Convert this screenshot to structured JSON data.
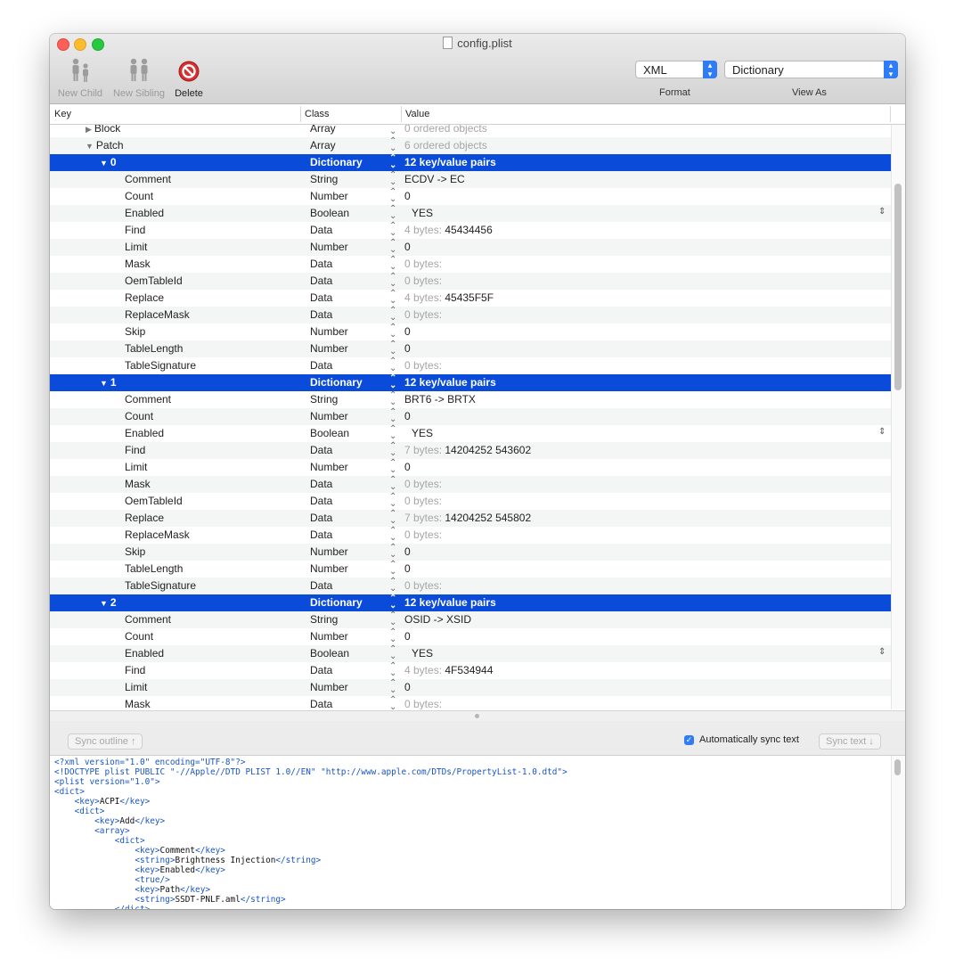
{
  "window": {
    "title": "config.plist"
  },
  "toolbar": {
    "new_child": "New Child",
    "new_sibling": "New Sibling",
    "delete": "Delete",
    "format_value": "XML",
    "format_label": "Format",
    "view_value": "Dictionary",
    "view_label": "View As"
  },
  "columns": {
    "key": "Key",
    "class": "Class",
    "value": "Value"
  },
  "rows": [
    {
      "key": "Block",
      "cls": "Array",
      "prefix": "",
      "value": "0 ordered objects",
      "level": 1,
      "disc": "▶",
      "muted": true
    },
    {
      "key": "Patch",
      "cls": "Array",
      "prefix": "",
      "value": "6 ordered objects",
      "level": 1,
      "disc": "▼",
      "muted": true
    },
    {
      "key": "0",
      "cls": "Dictionary",
      "prefix": "",
      "value": "12 key/value pairs",
      "level": 2,
      "disc": "▼",
      "sel": true
    },
    {
      "key": "Comment",
      "cls": "String",
      "prefix": "",
      "value": "ECDV -> EC",
      "level": 3
    },
    {
      "key": "Count",
      "cls": "Number",
      "prefix": "",
      "value": "0",
      "level": 3
    },
    {
      "key": "Enabled",
      "cls": "Boolean",
      "prefix": "",
      "value": "YES",
      "level": 3,
      "bool": true
    },
    {
      "key": "Find",
      "cls": "Data",
      "prefix": "4 bytes: ",
      "value": "45434456",
      "level": 3
    },
    {
      "key": "Limit",
      "cls": "Number",
      "prefix": "",
      "value": "0",
      "level": 3
    },
    {
      "key": "Mask",
      "cls": "Data",
      "prefix": "0 bytes:",
      "value": "",
      "level": 3
    },
    {
      "key": "OemTableId",
      "cls": "Data",
      "prefix": "0 bytes:",
      "value": "",
      "level": 3
    },
    {
      "key": "Replace",
      "cls": "Data",
      "prefix": "4 bytes: ",
      "value": "45435F5F",
      "level": 3
    },
    {
      "key": "ReplaceMask",
      "cls": "Data",
      "prefix": "0 bytes:",
      "value": "",
      "level": 3
    },
    {
      "key": "Skip",
      "cls": "Number",
      "prefix": "",
      "value": "0",
      "level": 3
    },
    {
      "key": "TableLength",
      "cls": "Number",
      "prefix": "",
      "value": "0",
      "level": 3
    },
    {
      "key": "TableSignature",
      "cls": "Data",
      "prefix": "0 bytes:",
      "value": "",
      "level": 3
    },
    {
      "key": "1",
      "cls": "Dictionary",
      "prefix": "",
      "value": "12 key/value pairs",
      "level": 2,
      "disc": "▼",
      "sel": true
    },
    {
      "key": "Comment",
      "cls": "String",
      "prefix": "",
      "value": "BRT6 -> BRTX",
      "level": 3
    },
    {
      "key": "Count",
      "cls": "Number",
      "prefix": "",
      "value": "0",
      "level": 3
    },
    {
      "key": "Enabled",
      "cls": "Boolean",
      "prefix": "",
      "value": "YES",
      "level": 3,
      "bool": true
    },
    {
      "key": "Find",
      "cls": "Data",
      "prefix": "7 bytes: ",
      "value": "14204252 543602",
      "level": 3
    },
    {
      "key": "Limit",
      "cls": "Number",
      "prefix": "",
      "value": "0",
      "level": 3
    },
    {
      "key": "Mask",
      "cls": "Data",
      "prefix": "0 bytes:",
      "value": "",
      "level": 3
    },
    {
      "key": "OemTableId",
      "cls": "Data",
      "prefix": "0 bytes:",
      "value": "",
      "level": 3
    },
    {
      "key": "Replace",
      "cls": "Data",
      "prefix": "7 bytes: ",
      "value": "14204252 545802",
      "level": 3
    },
    {
      "key": "ReplaceMask",
      "cls": "Data",
      "prefix": "0 bytes:",
      "value": "",
      "level": 3
    },
    {
      "key": "Skip",
      "cls": "Number",
      "prefix": "",
      "value": "0",
      "level": 3
    },
    {
      "key": "TableLength",
      "cls": "Number",
      "prefix": "",
      "value": "0",
      "level": 3
    },
    {
      "key": "TableSignature",
      "cls": "Data",
      "prefix": "0 bytes:",
      "value": "",
      "level": 3
    },
    {
      "key": "2",
      "cls": "Dictionary",
      "prefix": "",
      "value": "12 key/value pairs",
      "level": 2,
      "disc": "▼",
      "sel": true
    },
    {
      "key": "Comment",
      "cls": "String",
      "prefix": "",
      "value": "OSID -> XSID",
      "level": 3
    },
    {
      "key": "Count",
      "cls": "Number",
      "prefix": "",
      "value": "0",
      "level": 3
    },
    {
      "key": "Enabled",
      "cls": "Boolean",
      "prefix": "",
      "value": "YES",
      "level": 3,
      "bool": true
    },
    {
      "key": "Find",
      "cls": "Data",
      "prefix": "4 bytes: ",
      "value": "4F534944",
      "level": 3
    },
    {
      "key": "Limit",
      "cls": "Number",
      "prefix": "",
      "value": "0",
      "level": 3
    },
    {
      "key": "Mask",
      "cls": "Data",
      "prefix": "0 bytes:",
      "value": "",
      "level": 3
    }
  ],
  "sync": {
    "sync_outline": "Sync outline ↑",
    "auto_sync": "Automatically sync text",
    "auto_sync_checked": true,
    "sync_text": "Sync text ↓"
  },
  "code_lines": [
    [
      {
        "t": "tag",
        "s": "<?xml version=\"1.0\" encoding=\"UTF-8\"?>"
      }
    ],
    [
      {
        "t": "tag",
        "s": "<!DOCTYPE plist PUBLIC \"-//Apple//DTD PLIST 1.0//EN\" \"http://www.apple.com/DTDs/PropertyList-1.0.dtd\">"
      }
    ],
    [
      {
        "t": "tag",
        "s": "<plist version=\"1.0\">"
      }
    ],
    [
      {
        "t": "tag",
        "s": "<dict>"
      }
    ],
    [
      {
        "t": "txt",
        "s": "    "
      },
      {
        "t": "tag",
        "s": "<key>"
      },
      {
        "t": "txt",
        "s": "ACPI"
      },
      {
        "t": "tag",
        "s": "</key>"
      }
    ],
    [
      {
        "t": "txt",
        "s": "    "
      },
      {
        "t": "tag",
        "s": "<dict>"
      }
    ],
    [
      {
        "t": "txt",
        "s": "        "
      },
      {
        "t": "tag",
        "s": "<key>"
      },
      {
        "t": "txt",
        "s": "Add"
      },
      {
        "t": "tag",
        "s": "</key>"
      }
    ],
    [
      {
        "t": "txt",
        "s": "        "
      },
      {
        "t": "tag",
        "s": "<array>"
      }
    ],
    [
      {
        "t": "txt",
        "s": "            "
      },
      {
        "t": "tag",
        "s": "<dict>"
      }
    ],
    [
      {
        "t": "txt",
        "s": "                "
      },
      {
        "t": "tag",
        "s": "<key>"
      },
      {
        "t": "txt",
        "s": "Comment"
      },
      {
        "t": "tag",
        "s": "</key>"
      }
    ],
    [
      {
        "t": "txt",
        "s": "                "
      },
      {
        "t": "tag",
        "s": "<string>"
      },
      {
        "t": "txt",
        "s": "Brightness Injection"
      },
      {
        "t": "tag",
        "s": "</string>"
      }
    ],
    [
      {
        "t": "txt",
        "s": "                "
      },
      {
        "t": "tag",
        "s": "<key>"
      },
      {
        "t": "txt",
        "s": "Enabled"
      },
      {
        "t": "tag",
        "s": "</key>"
      }
    ],
    [
      {
        "t": "txt",
        "s": "                "
      },
      {
        "t": "tag",
        "s": "<true/>"
      }
    ],
    [
      {
        "t": "txt",
        "s": "                "
      },
      {
        "t": "tag",
        "s": "<key>"
      },
      {
        "t": "txt",
        "s": "Path"
      },
      {
        "t": "tag",
        "s": "</key>"
      }
    ],
    [
      {
        "t": "txt",
        "s": "                "
      },
      {
        "t": "tag",
        "s": "<string>"
      },
      {
        "t": "txt",
        "s": "SSDT-PNLF.aml"
      },
      {
        "t": "tag",
        "s": "</string>"
      }
    ],
    [
      {
        "t": "txt",
        "s": "            "
      },
      {
        "t": "tag",
        "s": "</dict>"
      }
    ]
  ],
  "icons": {
    "doc": "document-icon",
    "child": "new-child-icon",
    "sibling": "new-sibling-icon",
    "delete": "delete-icon"
  },
  "colors": {
    "selection": "#0a4bd9",
    "accent": "#2e7cf6",
    "close": "#fc5f57",
    "minimize": "#fdbc2e",
    "zoom": "#28c840"
  }
}
